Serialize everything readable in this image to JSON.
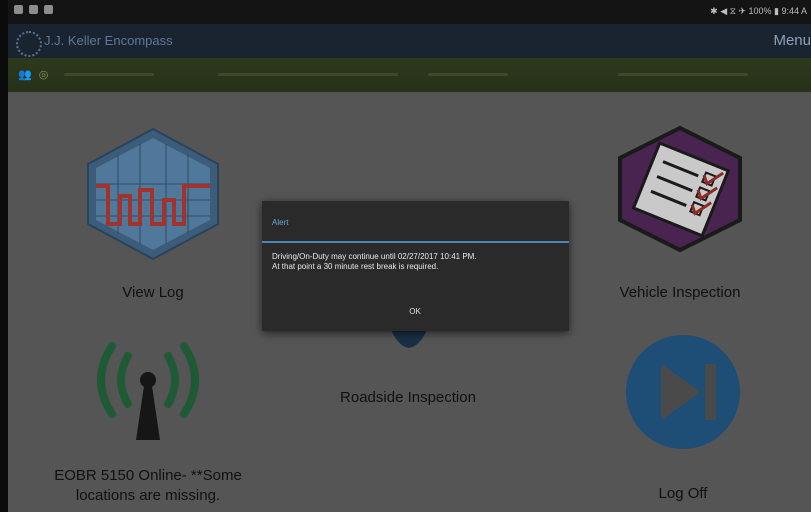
{
  "status_bar": {
    "right_text": "✱ ◀ ⧖ ✈ 100% ▮ 9:44 A"
  },
  "app_bar": {
    "title": "J.J. Keller Encompass",
    "menu_label": "Menu"
  },
  "tiles": {
    "view_log": {
      "label": "View Log",
      "icon": "log-grid-icon"
    },
    "vehicle_inspection": {
      "label": "Vehicle Inspection",
      "icon": "checklist-icon"
    },
    "eobr": {
      "label": "EOBR 5150 Online- **Some locations are missing.",
      "icon": "wireless-antenna-icon"
    },
    "roadside_inspection": {
      "label": "Roadside Inspection",
      "icon": "badge-icon"
    },
    "log_off": {
      "label": "Log Off",
      "icon": "skip-forward-icon"
    }
  },
  "dialog": {
    "title": "Alert",
    "message": "Driving/On-Duty may continue until 02/27/2017 10:41 PM.\nAt that point a 30 minute rest break is required.",
    "ok_label": "OK"
  },
  "colors": {
    "accent_blue": "#4a86b8",
    "log_red": "#b33a2c",
    "inspection_purple": "#5b2c5e",
    "antenna_green": "#1f5a36",
    "logoff_blue": "#1e4d75"
  }
}
